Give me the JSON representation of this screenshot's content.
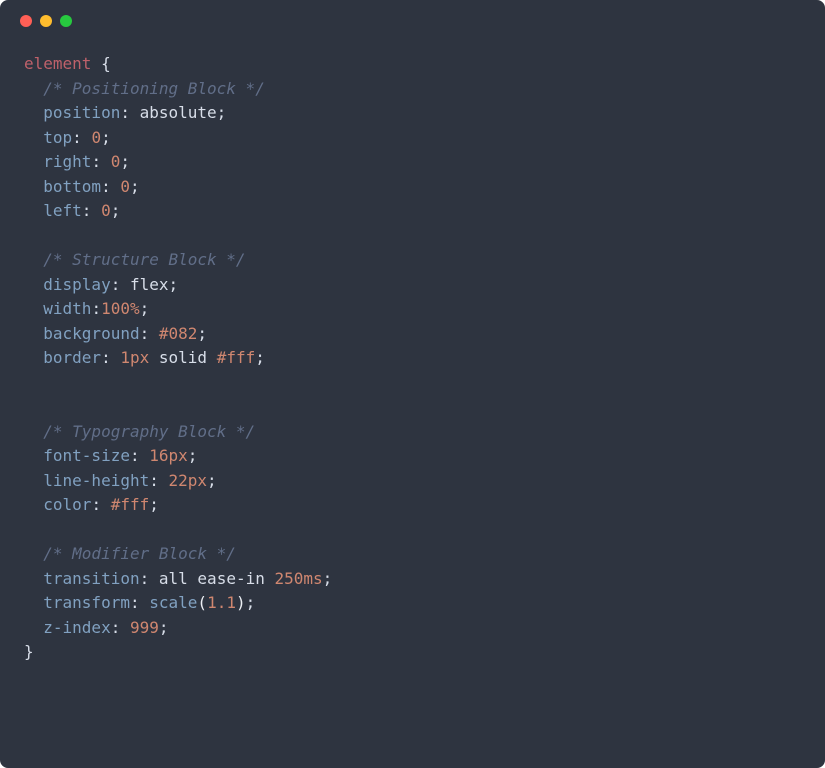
{
  "code": {
    "selector": "element",
    "open_brace": "{",
    "close_brace": "}",
    "comments": {
      "positioning": "/* Positioning Block */",
      "structure": "/* Structure Block */",
      "typography": "/* Typography Block */",
      "modifier": "/* Modifier Block */"
    },
    "properties": {
      "position": "position",
      "top": "top",
      "right": "right",
      "bottom": "bottom",
      "left": "left",
      "display": "display",
      "width": "width",
      "background": "background",
      "border": "border",
      "font_size": "font-size",
      "line_height": "line-height",
      "color": "color",
      "transition": "transition",
      "transform": "transform",
      "z_index": "z-index"
    },
    "values": {
      "absolute": "absolute",
      "zero": "0",
      "flex": "flex",
      "width_100": "100%",
      "bg_hex": "#082",
      "border_px": "1px",
      "border_solid": "solid",
      "border_hex": "#fff",
      "font_size_px": "16px",
      "line_height_px": "22px",
      "color_hex": "#fff",
      "transition_all": "all",
      "transition_ease": "ease-in",
      "transition_time": "250ms",
      "transform_scale": "scale",
      "scale_val": "1.1",
      "z_index_val": "999"
    },
    "punct": {
      "colon": ":",
      "semicolon": ";",
      "paren_open": "(",
      "paren_close": ")"
    }
  }
}
